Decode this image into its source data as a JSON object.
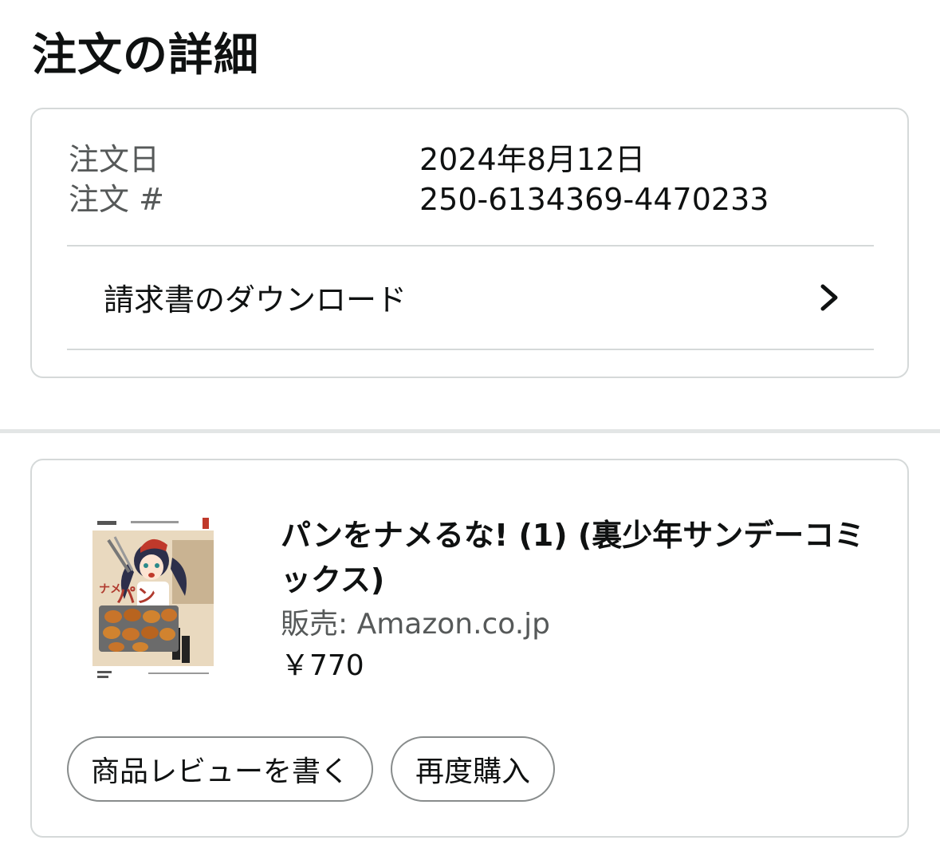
{
  "page": {
    "title": "注文の詳細"
  },
  "summary": {
    "order_date_label": "注文日",
    "order_date_value": "2024年8月12日",
    "order_number_label": "注文 #",
    "order_number_value": "250-6134369-4470233",
    "invoice_label": "請求書のダウンロード"
  },
  "item": {
    "title": "パンをナメるな! (1) (裏少年サンデーコミックス)",
    "seller": "販売: Amazon.co.jp",
    "price": "￥770",
    "cover_alt_text": "パンをナメるな!"
  },
  "actions": {
    "review_label": "商品レビューを書く",
    "rebuy_label": "再度購入"
  },
  "colors": {
    "text_primary": "#0f1111",
    "text_secondary": "#565959",
    "border": "#d5d9d9",
    "button_border": "#888c8c"
  },
  "icons": {
    "invoice_chevron": "chevron-right-icon"
  }
}
